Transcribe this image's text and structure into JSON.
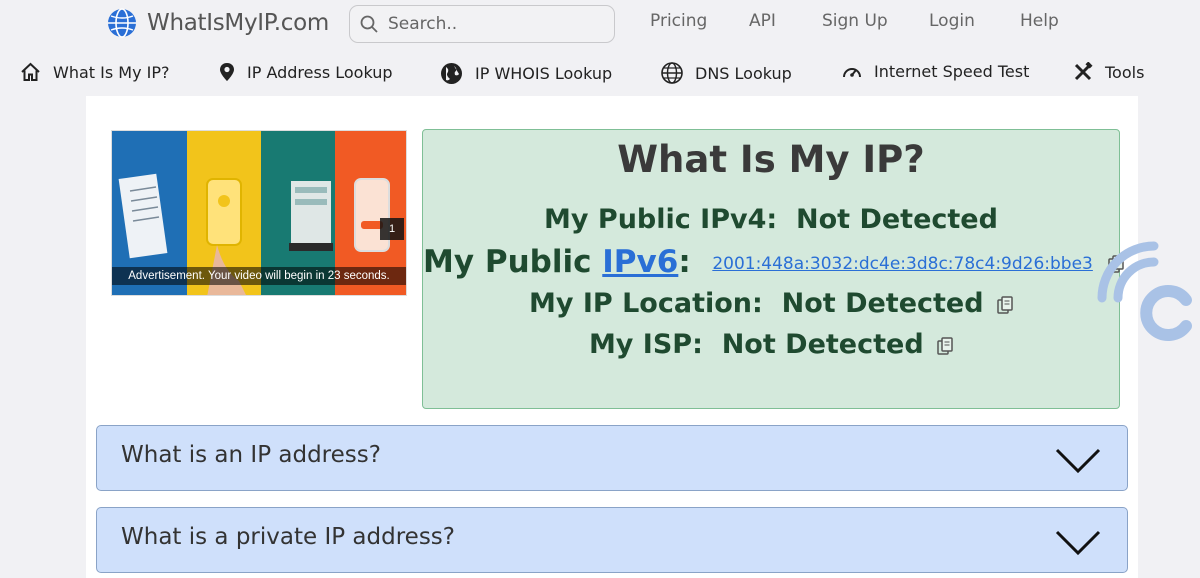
{
  "header": {
    "logo_text": "WhatIsMyIP.com",
    "search_placeholder": "Search..",
    "links": [
      "Pricing",
      "API",
      "Sign Up",
      "Login",
      "Help"
    ]
  },
  "nav": {
    "items": [
      {
        "label": "What Is My IP?",
        "icon": "home-icon"
      },
      {
        "label": "IP Address Lookup",
        "icon": "map-pin-icon"
      },
      {
        "label": "IP WHOIS Lookup",
        "icon": "globe-icon"
      },
      {
        "label": "DNS Lookup",
        "icon": "dns-icon"
      },
      {
        "label": "Internet Speed Test",
        "icon": "speedometer-icon"
      },
      {
        "label": "Tools",
        "icon": "tools-icon"
      }
    ]
  },
  "ad": {
    "caption": "Advertisement. Your video will begin in 23 seconds.",
    "count": "1",
    "colors": [
      "#1f6fb5",
      "#f2c41b",
      "#187a72",
      "#f15a24"
    ]
  },
  "ip_info": {
    "title": "What Is My IP?",
    "ipv4_label": "My Public IPv4:",
    "ipv4_value": "Not Detected",
    "ipv6_label_prefix": "My Public",
    "ipv6_link": "IPv6",
    "ipv6_colon": ":",
    "ipv6_value": "2001:448a:3032:dc4e:3d8c:78c4:9d26:bbe3",
    "location_label": "My IP Location:",
    "location_value": "Not Detected",
    "isp_label": "My ISP:",
    "isp_value": "Not Detected"
  },
  "faq": [
    {
      "question": "What is an IP address?"
    },
    {
      "question": "What is a private IP address?"
    }
  ],
  "colors": {
    "panel_green": "#d4e9dc",
    "faq_blue": "#cfe0fb",
    "link_blue": "#2a6fd6"
  }
}
